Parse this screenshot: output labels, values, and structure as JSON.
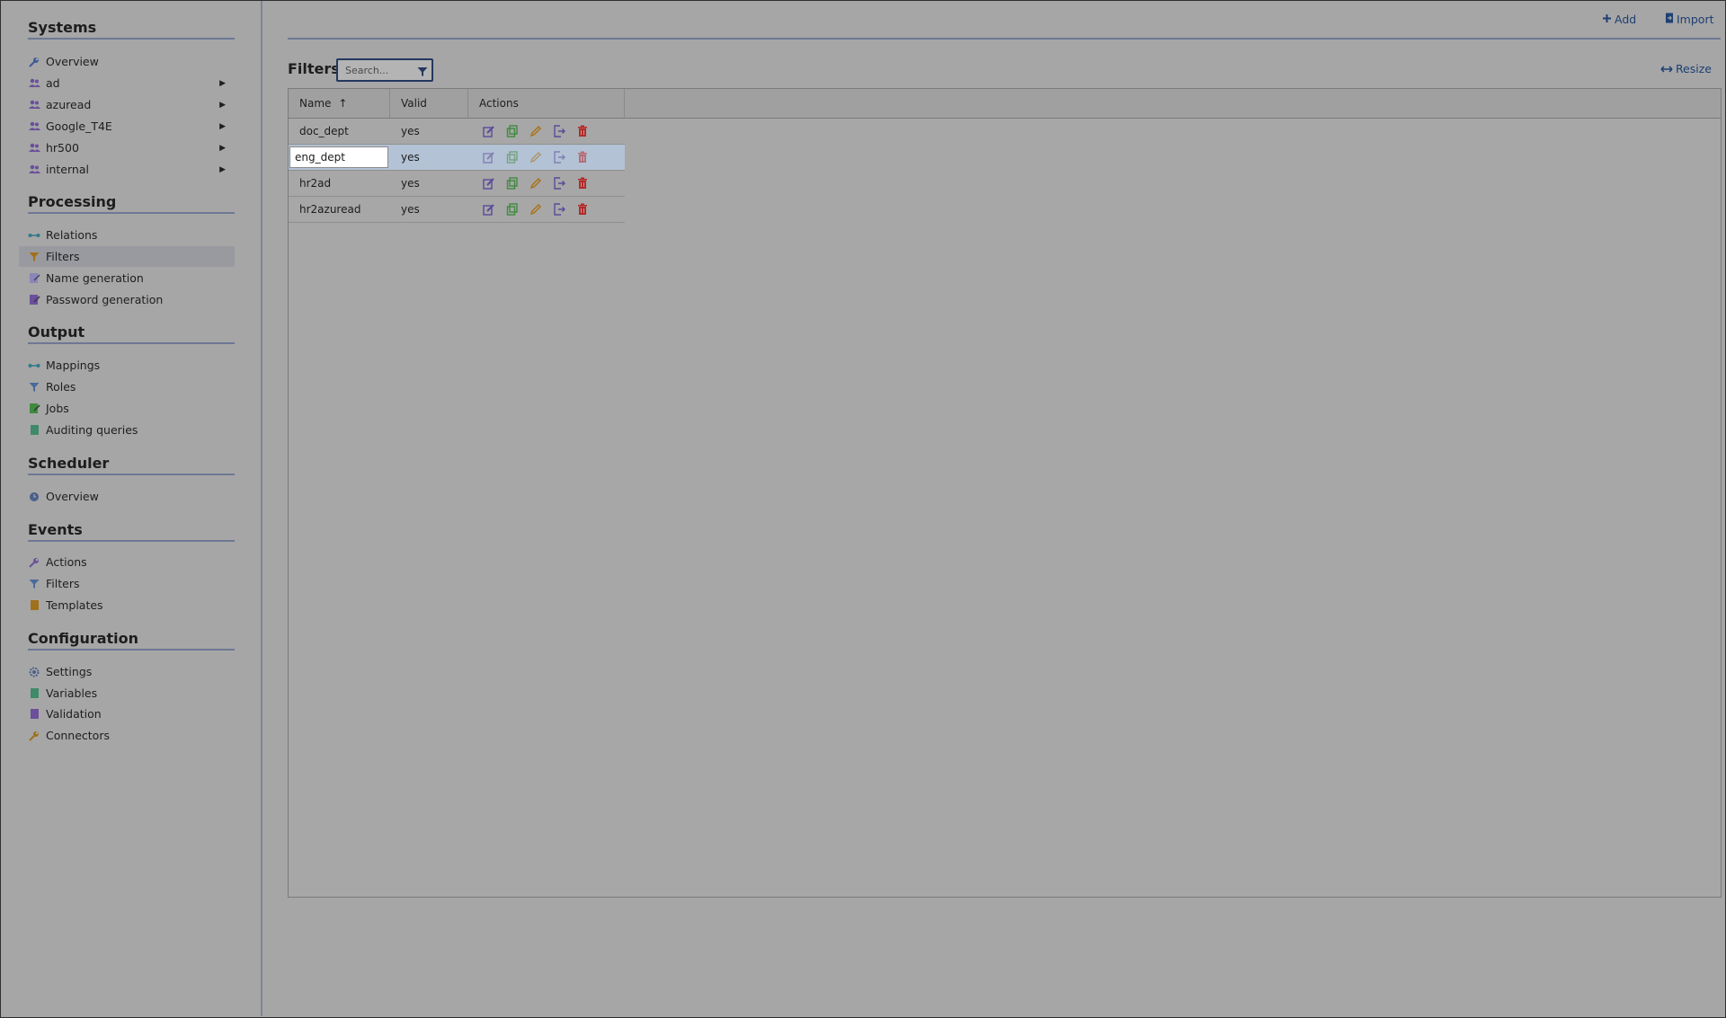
{
  "sidebar": {
    "sections": [
      {
        "title": "Systems",
        "items": [
          {
            "label": "Overview",
            "icon": "wrench-icon"
          },
          {
            "label": "ad",
            "icon": "users-icon",
            "has_submenu": true
          },
          {
            "label": "azuread",
            "icon": "users-icon",
            "has_submenu": true
          },
          {
            "label": "Google_T4E",
            "icon": "users-icon",
            "has_submenu": true
          },
          {
            "label": "hr500",
            "icon": "users-icon",
            "has_submenu": true
          },
          {
            "label": "internal",
            "icon": "users-icon",
            "has_submenu": true
          }
        ]
      },
      {
        "title": "Processing",
        "items": [
          {
            "label": "Relations",
            "icon": "relations-icon"
          },
          {
            "label": "Filters",
            "icon": "filter-icon",
            "active": true
          },
          {
            "label": "Name generation",
            "icon": "edit-doc-icon"
          },
          {
            "label": "Password generation",
            "icon": "edit-doc-icon"
          }
        ]
      },
      {
        "title": "Output",
        "items": [
          {
            "label": "Mappings",
            "icon": "relations-icon"
          },
          {
            "label": "Roles",
            "icon": "filter-icon"
          },
          {
            "label": "Jobs",
            "icon": "edit-doc-icon"
          },
          {
            "label": "Auditing queries",
            "icon": "document-icon"
          }
        ]
      },
      {
        "title": "Scheduler",
        "items": [
          {
            "label": "Overview",
            "icon": "clock-icon"
          }
        ]
      },
      {
        "title": "Events",
        "items": [
          {
            "label": "Actions",
            "icon": "wrench-icon"
          },
          {
            "label": "Filters",
            "icon": "filter-icon"
          },
          {
            "label": "Templates",
            "icon": "document-icon"
          }
        ]
      },
      {
        "title": "Configuration",
        "items": [
          {
            "label": "Settings",
            "icon": "gear-icon"
          },
          {
            "label": "Variables",
            "icon": "document-icon"
          },
          {
            "label": "Validation",
            "icon": "document-icon"
          },
          {
            "label": "Connectors",
            "icon": "wrench-icon"
          }
        ]
      }
    ]
  },
  "toolbar": {
    "add_label": "Add",
    "import_label": "Import",
    "resize_label": "Resize"
  },
  "page": {
    "title": "Filters",
    "search_placeholder": "Search..."
  },
  "table": {
    "columns": [
      "Name",
      "Valid",
      "Actions"
    ],
    "sort_indicator": "↑",
    "rows": [
      {
        "name": "doc_dept",
        "valid": "yes"
      },
      {
        "name": "eng_dept",
        "valid": "yes",
        "editing": true
      },
      {
        "name": "hr2ad",
        "valid": "yes"
      },
      {
        "name": "hr2azuread",
        "valid": "yes"
      }
    ],
    "row_actions": [
      "edit-icon",
      "copy-icon",
      "rename-icon",
      "export-icon",
      "delete-icon"
    ]
  },
  "colors": {
    "link": "#1d3f73",
    "edit": "#5b4a9a",
    "copy": "#3f8a3f",
    "rename": "#a8731a",
    "export": "#5b4a9a",
    "delete": "#b52a2a",
    "section_rule": "#6e7894"
  }
}
